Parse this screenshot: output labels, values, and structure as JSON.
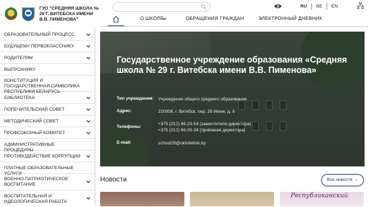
{
  "header": {
    "school_name": "ГУО \"СРЕДНЯЯ ШКОЛА № 29 Г. ВИТЕБСКА ИМЕНИ В.В. ПИМЕНОВА\"",
    "search_placeholder": "",
    "languages": [
      {
        "label": "RU",
        "active": true
      },
      {
        "label": "BE",
        "active": false
      },
      {
        "label": "EN",
        "active": false
      }
    ]
  },
  "topnav": {
    "items": [
      {
        "label": "О ШКОЛЕ",
        "has_dropdown": true
      },
      {
        "label": "ОБРАЩЕНИЯ ГРАЖДАН",
        "has_dropdown": false
      },
      {
        "label": "ЭЛЕКТРОННЫЙ ДНЕВНИК",
        "has_dropdown": false
      }
    ]
  },
  "sidebar": {
    "items": [
      {
        "label": "ОБРАЗОВАТЕЛЬНЫЙ ПРОЦЕСС",
        "has_dropdown": true
      },
      {
        "label": "БУДУЩЕМУ ПЕРВОКЛАССНИКУ",
        "has_dropdown": true
      },
      {
        "label": "РОДИТЕЛЯМ",
        "has_dropdown": true
      },
      {
        "label": "ВЫПУСКНИКУ",
        "has_dropdown": false
      },
      {
        "label": "КОНСТИТУЦИЯ И ГОСУДАРСТВЕННАЯ СИМВОЛИКА РЕСПУБЛИКИ БЕЛАРУСЬ",
        "has_dropdown": false
      },
      {
        "label": "БИБЛИОТЕКА",
        "has_dropdown": true
      },
      {
        "label": "ПОПЕЧИТЕЛЬСКИЙ СОВЕТ",
        "has_dropdown": true
      },
      {
        "label": "МЕТОДИЧЕСКИЙ СОВЕТ",
        "has_dropdown": true
      },
      {
        "label": "ПРОФСОЮЗНЫЙ КОМИТЕТ",
        "has_dropdown": true
      },
      {
        "label": "АДМИНИСТРАТИВНЫЕ ПРОЦЕДУРЫ",
        "has_dropdown": false
      },
      {
        "label": "ПРОТИВОДЕЙСТВИЕ КОРРУПЦИИ",
        "has_dropdown": true
      },
      {
        "label": "ПЛАТНЫЕ ОБРАЗОВАТЕЛЬНЫЕ УСЛУГИ",
        "has_dropdown": false
      },
      {
        "label": "ВОЕННО-ПАТРИОТИЧЕСКОЕ ВОСПИТАНИЕ",
        "has_dropdown": true
      },
      {
        "label": "ВОСПИТАТЕЛЬНАЯ И ИДЕОЛОГИЧЕСКАЯ РАБОТА",
        "has_dropdown": true
      }
    ]
  },
  "hero": {
    "title": "Государственное учреждение образования «Средняя школа № 29 г. Витебска имени В.В. Пименова»",
    "type_label": "Тип учреждения:",
    "type_value": "Учреждение общего среднего образования",
    "address_label": "Адрес:",
    "address_value": "210009, г. Витебск, пер. 26 Июня, д. 6",
    "phones_label": "Телефоны:",
    "phone1": "+375 (212) 66-23-54 (заместители директора)",
    "phone2": "+375 (212) 66-35-34 (приёмная директора)",
    "email_label": "E-mail:",
    "email_value": "school29@oktvitebsk.by"
  },
  "news": {
    "title": "Новости",
    "all_news_label": "Все новости →",
    "card3_text": "Республиканский"
  },
  "colors": {
    "accent": "#1d3a8a",
    "hero_overlay": "#2f3834"
  }
}
